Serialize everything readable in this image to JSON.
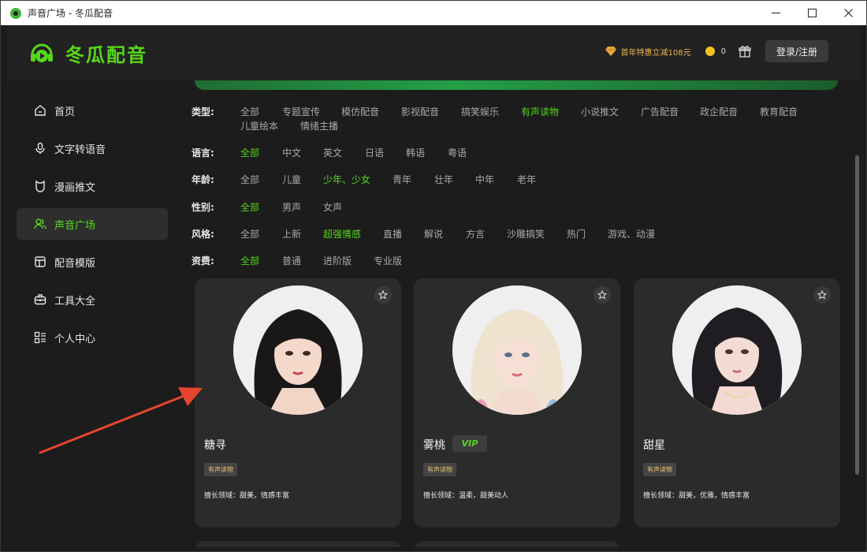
{
  "window": {
    "title": "声音广场 - 冬瓜配音"
  },
  "header": {
    "brand": "冬瓜配音",
    "promo": "首年特惠立减108元",
    "coins": "0",
    "login_label": "登录/注册"
  },
  "sidebar": {
    "items": [
      {
        "label": "首页",
        "icon": "home-icon"
      },
      {
        "label": "文字转语音",
        "icon": "microphone-icon"
      },
      {
        "label": "漫画推文",
        "icon": "comic-icon"
      },
      {
        "label": "声音广场",
        "icon": "users-icon",
        "active": true
      },
      {
        "label": "配音模版",
        "icon": "template-icon"
      },
      {
        "label": "工具大全",
        "icon": "toolbox-icon"
      },
      {
        "label": "个人中心",
        "icon": "profile-icon"
      }
    ]
  },
  "filters": {
    "type": {
      "label": "类型:",
      "options": [
        "全部",
        "专题宣传",
        "模仿配音",
        "影视配音",
        "搞笑娱乐",
        "有声读物",
        "小说推文",
        "广告配音",
        "政企配音",
        "教育配音",
        "儿童绘本",
        "情绪主播"
      ],
      "selected": "有声读物"
    },
    "language": {
      "label": "语言:",
      "options": [
        "全部",
        "中文",
        "英文",
        "日语",
        "韩语",
        "粤语"
      ],
      "selected": "全部"
    },
    "age": {
      "label": "年龄:",
      "options": [
        "全部",
        "儿童",
        "少年、少女",
        "青年",
        "壮年",
        "中年",
        "老年"
      ],
      "selected": "少年、少女"
    },
    "gender": {
      "label": "性别:",
      "options": [
        "全部",
        "男声",
        "女声"
      ],
      "selected": "全部"
    },
    "style": {
      "label": "风格:",
      "options": [
        "全部",
        "上新",
        "超强情感",
        "直播",
        "解说",
        "方言",
        "沙雕搞笑",
        "热门",
        "游戏、动漫"
      ],
      "selected": "超强情感"
    },
    "fee": {
      "label": "资费:",
      "options": [
        "全部",
        "普通",
        "进阶版",
        "专业版"
      ],
      "selected": "全部"
    }
  },
  "voices": [
    {
      "name": "糖寻",
      "vip": false,
      "tag": "有声读物",
      "desc": "擅长领域：甜美，情感丰富",
      "hair": "#1a1718"
    },
    {
      "name": "雾桃",
      "vip": true,
      "vip_label": "VIP",
      "tag": "有声读物",
      "desc": "擅长领域：温柔，甜美动人",
      "hair": "#efe3cf"
    },
    {
      "name": "甜星",
      "vip": false,
      "tag": "有声读物",
      "desc": "擅长领域：甜美，优雅，情感丰富",
      "hair": "#201d22"
    }
  ],
  "colors": {
    "accent": "#56d61c",
    "annotation_arrow": "#e5462e"
  }
}
